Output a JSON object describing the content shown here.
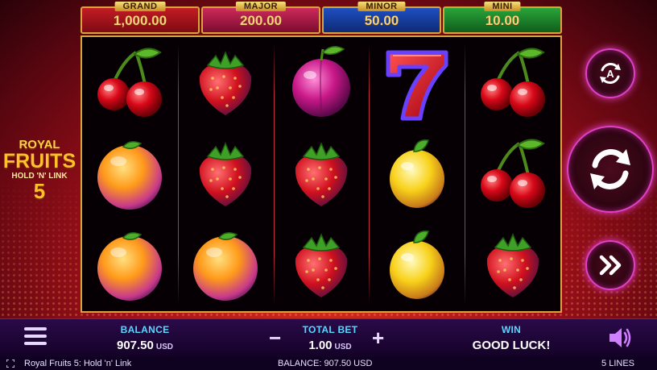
{
  "jackpots": {
    "grand": {
      "label": "GRAND",
      "value": "1,000.00"
    },
    "major": {
      "label": "MAJOR",
      "value": "200.00"
    },
    "minor": {
      "label": "MINOR",
      "value": "50.00"
    },
    "mini": {
      "label": "MINI",
      "value": "10.00"
    }
  },
  "logo": {
    "line1": "ROYAL",
    "line2": "FRUITS",
    "line3": "HOLD 'N' LINK",
    "line4": "5"
  },
  "reels": [
    [
      "cherry",
      "orange",
      "orange"
    ],
    [
      "strawberry",
      "strawberry",
      "orange"
    ],
    [
      "plum",
      "strawberry",
      "strawberry"
    ],
    [
      "seven",
      "lemon",
      "lemon"
    ],
    [
      "cherry",
      "cherry",
      "strawberry"
    ]
  ],
  "controls": {
    "autoplay_icon": "autoplay-icon",
    "autoplay_letter": "A",
    "spin_icon": "spin-icon",
    "turbo_icon": "fast-forward-icon"
  },
  "bottom": {
    "balance_label": "BALANCE",
    "balance_value": "907.50",
    "balance_currency": "USD",
    "bet_label": "TOTAL BET",
    "bet_value": "1.00",
    "bet_currency": "USD",
    "bet_minus": "−",
    "bet_plus": "+",
    "win_label": "WIN",
    "win_value": "GOOD LUCK!"
  },
  "status": {
    "game_name": "Royal Fruits 5: Hold 'n' Link",
    "balance": "BALANCE: 907.50 USD",
    "lines": "5 LINES"
  },
  "colors": {
    "gold": "#d9a440",
    "grand": "#c31c24",
    "major": "#cc2a5a",
    "minor": "#1f4fc0",
    "mini": "#2aa43a",
    "accent_pink": "#e040c8",
    "label_cyan": "#58d8ff"
  }
}
